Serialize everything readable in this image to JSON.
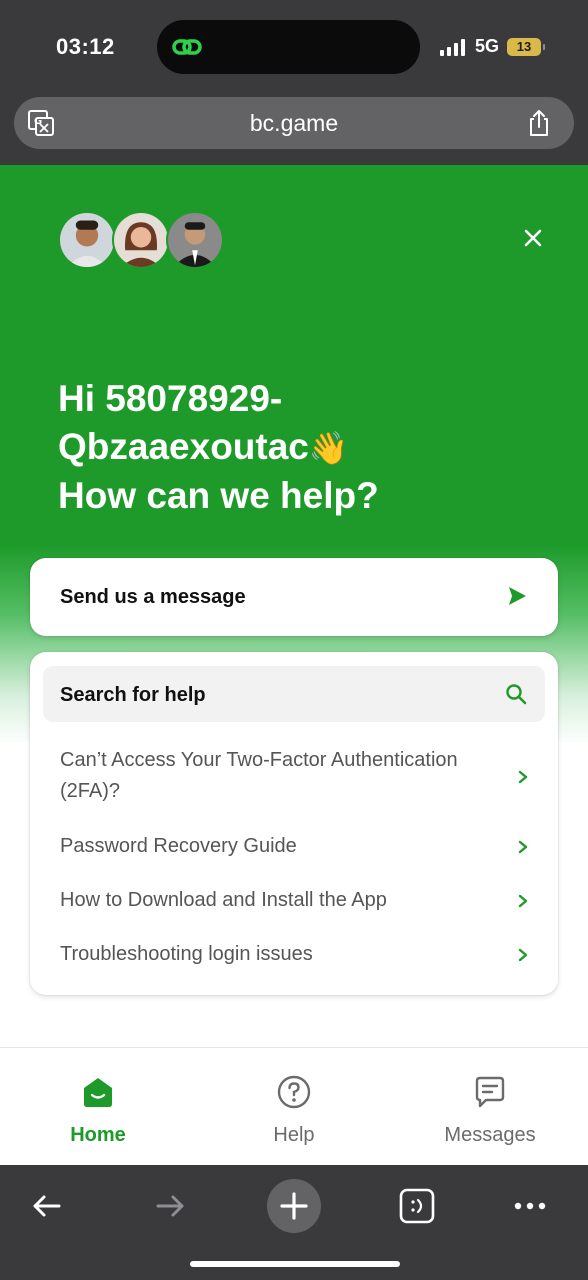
{
  "status_bar": {
    "time": "03:12",
    "network": "5G",
    "battery": "13"
  },
  "browser": {
    "url": "bc.game",
    "icons": [
      "translate-icon",
      "share-icon",
      "back-arrow-icon",
      "forward-arrow-icon",
      "plus-icon",
      "tabs-icon",
      "more-icon"
    ]
  },
  "hero": {
    "greeting_line1": "Hi 58078929-",
    "greeting_line2": "Qbzaaexoutac",
    "greeting_emoji": "👋",
    "greeting_line3": "How can we help?"
  },
  "send_card": {
    "label": "Send us a message"
  },
  "help_card": {
    "search_label": "Search for help",
    "articles": [
      {
        "title": "Can’t Access Your Two-Factor Authentication (2FA)?"
      },
      {
        "title": "Password Recovery Guide"
      },
      {
        "title": "How to Download and Install the App"
      },
      {
        "title": "Troubleshooting login issues"
      }
    ]
  },
  "bottom_nav": {
    "items": [
      {
        "label": "Home",
        "active": true
      },
      {
        "label": "Help",
        "active": false
      },
      {
        "label": "Messages",
        "active": false
      }
    ]
  },
  "colors": {
    "brand_green": "#1e9a2a",
    "chrome_dark": "#3a3a3c",
    "battery_yellow": "#d9b94a"
  }
}
